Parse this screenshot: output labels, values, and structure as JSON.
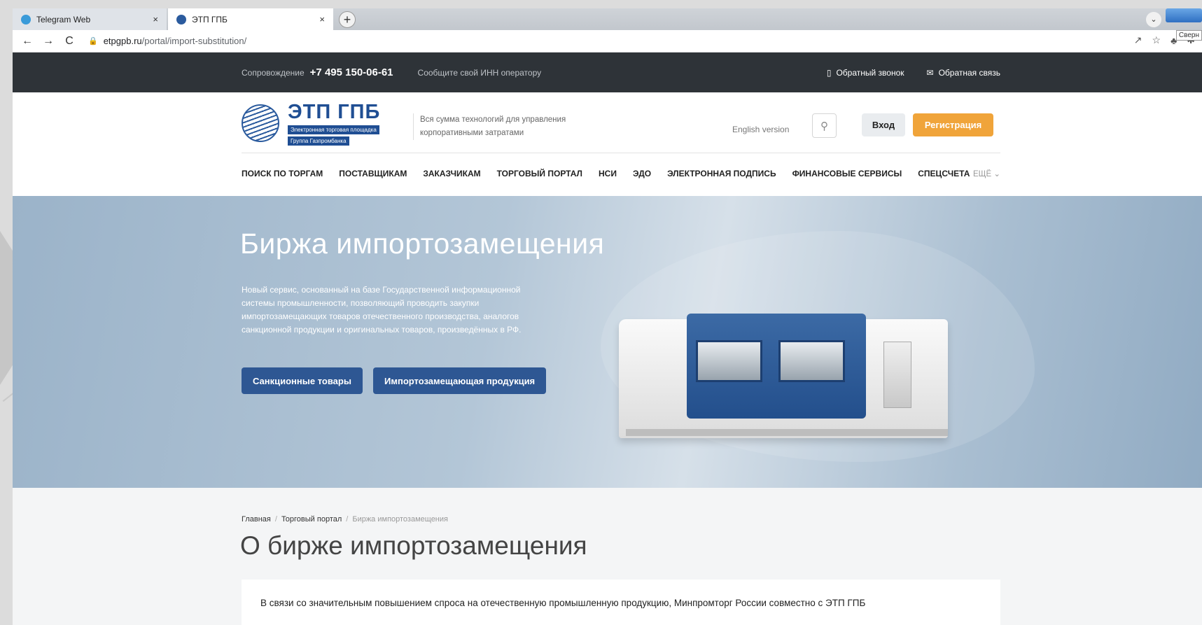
{
  "browser": {
    "tabs": [
      {
        "title": "Telegram Web",
        "close": "×",
        "active": false,
        "favicon_color": "#3a9bd9"
      },
      {
        "title": "ЭТП ГПБ",
        "close": "×",
        "active": true,
        "favicon_color": "#2b5b9e"
      }
    ],
    "new_tab": "+",
    "tab_menu": "⌄",
    "nav": {
      "back": "←",
      "forward": "→",
      "reload": "C"
    },
    "url_host": "etpgpb.ru",
    "url_path": "/portal/import-substitution/",
    "tooltip": "Сверн"
  },
  "topbar": {
    "support_label": "Сопровождение",
    "phone": "+7 495 150-06-61",
    "inn_hint": "Сообщите свой ИНН оператору",
    "callback": "Обратный звонок",
    "feedback": "Обратная связь"
  },
  "header": {
    "logo_title": "ЭТП ГПБ",
    "logo_sub1": "Электронная торговая площадка",
    "logo_sub2": "Группа Газпромбанка",
    "tagline": "Вся сумма технологий для управления корпоративными затратами",
    "english": "English version",
    "login": "Вход",
    "register": "Регистрация"
  },
  "nav": {
    "items": [
      "ПОИСК ПО ТОРГАМ",
      "ПОСТАВЩИКАМ",
      "ЗАКАЗЧИКАМ",
      "ТОРГОВЫЙ ПОРТАЛ",
      "НСИ",
      "ЭДО",
      "ЭЛЕКТРОННАЯ ПОДПИСЬ",
      "ФИНАНСОВЫЕ СЕРВИСЫ",
      "СПЕЦСЧЕТА"
    ],
    "more": "ЕЩЁ"
  },
  "hero": {
    "title": "Биржа импортозамещения",
    "text": "Новый сервис, основанный на базе Государственной информационной системы промышленности, позволяющий проводить закупки импортозамещающих товаров отечественного производства, аналогов санкционной продукции и оригинальных товаров, произведённых в РФ.",
    "btn_sanction": "Санкционные товары",
    "btn_import": "Импортозамещающая продукция"
  },
  "content": {
    "breadcrumbs": [
      "Главная",
      "Торговый портал",
      "Биржа импортозамещения"
    ],
    "heading": "О бирже импортозамещения",
    "paragraph": "В связи со значительным повышением спроса на отечественную промышленную продукцию, Минпромторг России совместно с ЭТП ГПБ"
  },
  "colors": {
    "topbar_bg": "#2e3338",
    "brand_blue": "#1f4e93",
    "accent_orange": "#f0a43a",
    "hero_button": "#2e5793"
  },
  "icons": [
    "telegram-favicon",
    "etp-favicon",
    "lock-icon",
    "share-icon",
    "star-icon",
    "extension-icon",
    "phone-icon",
    "mail-icon",
    "search-icon",
    "chevron-down-icon"
  ]
}
